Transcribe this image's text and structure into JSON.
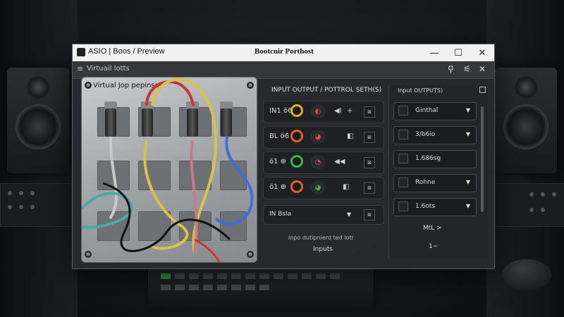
{
  "window": {
    "app_title": "ASIO | Boos / Preview",
    "doc_title": "Bootcnir Porthost",
    "controls": {
      "minimize": "—",
      "maximize": "☐",
      "close": "✕"
    }
  },
  "subbar": {
    "title": "Virtuail Iotts",
    "menu_glyph": "≡",
    "icons": {
      "pin": "⚲",
      "mute": "⚟",
      "close": "✕"
    }
  },
  "patchbay": {
    "label": "Virtual Jop pepinsel",
    "screw_glyph": "⊕"
  },
  "io_section": {
    "header": "INPUT OUTPUT / POTTROL SETH(S)",
    "channels": [
      {
        "label": "IN1 ö6",
        "knob_color": "#e0b21a",
        "btn_glyph": "◐",
        "btn_color": "#e34b3a",
        "ctl_a": "◀I",
        "ctl_b": "+",
        "box": "⊠"
      },
      {
        "label": "BL ö6",
        "knob_color": "#e0602a",
        "btn_glyph": "◕",
        "btn_color": "#e34b3a",
        "ctl_a": "◧",
        "ctl_b": "+",
        "box": "⊠"
      },
      {
        "label": "ö1 ⊕",
        "knob_color": "#35b54a",
        "btn_glyph": "◔",
        "btn_color": "#e34b3a",
        "ctl_a": "◀◀",
        "ctl_b": "+",
        "box": "⊠"
      },
      {
        "label": "ö1 ⊕",
        "knob_color": "#e0602a",
        "btn_glyph": "◕",
        "btn_color": "#35b54a",
        "ctl_a": "◧",
        "ctl_b": "⊕",
        "box": "⊠"
      }
    ],
    "select": {
      "label": "IN Bsla",
      "caret": "▼",
      "box": "⊠"
    },
    "footer_note": "Inpo dutipnierd ted lotr",
    "inputs_button": "Inputs"
  },
  "outputs": {
    "header": "Input OUTPUTS)",
    "items": [
      {
        "value": "Ginthal"
      },
      {
        "value": "3/b6io"
      },
      {
        "value": "1.686sg"
      },
      {
        "value": "Rohne"
      },
      {
        "value": "1.6ots"
      }
    ],
    "caret": "▼",
    "btn_a": "MtL >",
    "btn_b": "1−"
  },
  "colors": {
    "accent_yellow": "#e0b21a",
    "accent_red": "#e34b3a",
    "accent_green": "#35b54a",
    "cable_blue": "#3d6fd9"
  }
}
